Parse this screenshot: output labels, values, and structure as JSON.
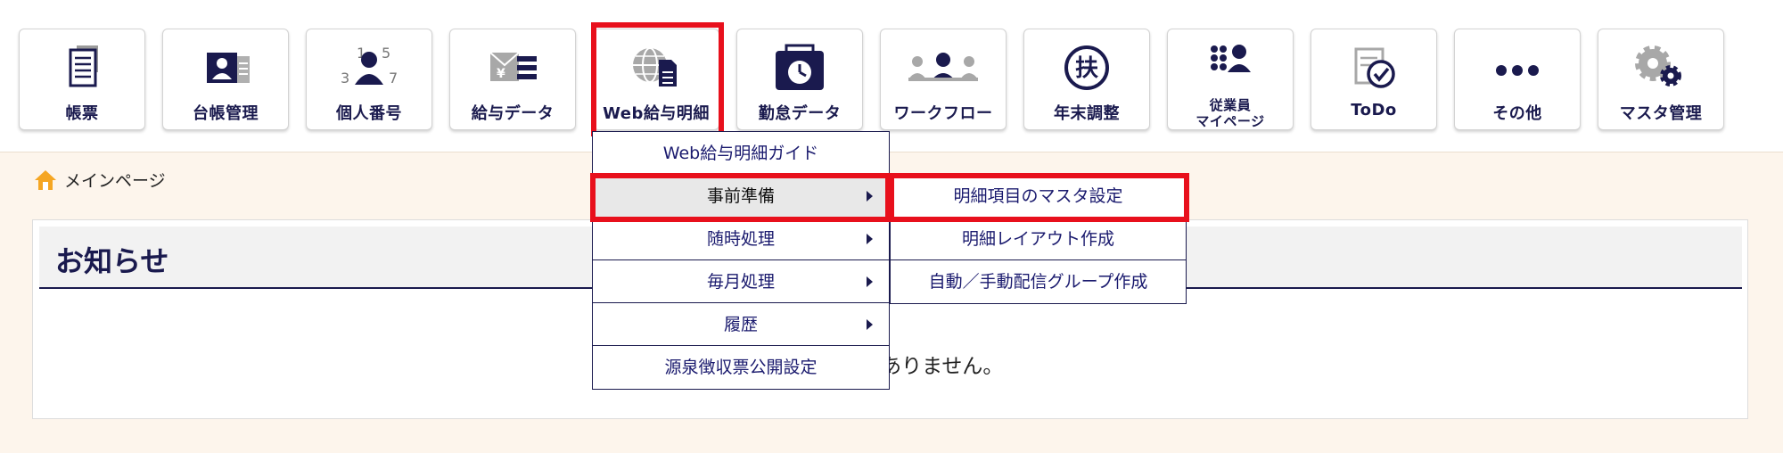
{
  "toolbar": {
    "tiles": [
      {
        "label": "帳票",
        "icon": "document-list-icon"
      },
      {
        "label": "台帳管理",
        "icon": "id-card-icon"
      },
      {
        "label": "個人番号",
        "icon": "person-number-icon"
      },
      {
        "label": "給与データ",
        "icon": "salary-envelope-icon"
      },
      {
        "label": "Web給与明細",
        "icon": "globe-document-icon"
      },
      {
        "label": "勤怠データ",
        "icon": "timecard-clock-icon"
      },
      {
        "label": "ワークフロー",
        "icon": "workflow-people-icon"
      },
      {
        "label": "年末調整",
        "icon": "fu-circle-icon"
      },
      {
        "label_line1": "従業員",
        "label_line2": "マイページ",
        "icon": "employee-grid-icon"
      },
      {
        "label": "ToDo",
        "icon": "todo-check-icon"
      },
      {
        "label": "その他",
        "icon": "more-dots-icon"
      },
      {
        "label": "マスタ管理",
        "icon": "gears-icon"
      }
    ],
    "fu_glyph": "扶"
  },
  "breadcrumb": {
    "label": "メインページ",
    "icon": "home-icon"
  },
  "notice": {
    "title": "お知らせ",
    "empty_text": "お知らせはありません。"
  },
  "menu": {
    "items": [
      "Web給与明細ガイド",
      "事前準備",
      "随時処理",
      "毎月処理",
      "履歴",
      "源泉徴収票公開設定"
    ]
  },
  "submenu": {
    "items": [
      "明細項目のマスタ設定",
      "明細レイアウト作成",
      "自動／手動配信グループ作成"
    ]
  },
  "colors": {
    "accent": "#1a1a4e",
    "highlight": "#e8101c",
    "background": "#fdf5ec",
    "icon_gray": "#9a9a9a"
  }
}
